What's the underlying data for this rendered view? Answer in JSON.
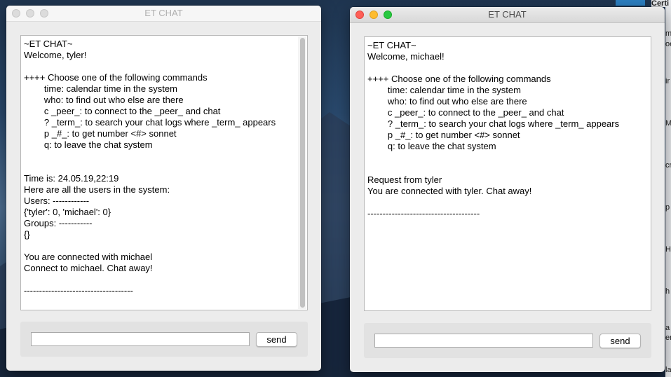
{
  "desktop": {
    "right_fragments": [
      "Certi",
      "m",
      "oe",
      "ir",
      "M",
      "cr",
      "p",
      "H",
      "h",
      "a",
      "er",
      "lar"
    ]
  },
  "windows": [
    {
      "title": "ET CHAT",
      "log_lines": [
        "~ET CHAT~",
        "Welcome, tyler!",
        "",
        "++++ Choose one of the following commands",
        "        time: calendar time in the system",
        "        who: to find out who else are there",
        "        c _peer_: to connect to the _peer_ and chat",
        "        ? _term_: to search your chat logs where _term_ appears",
        "        p _#_: to get number <#> sonnet",
        "        q: to leave the chat system",
        "",
        "",
        "Time is: 24.05.19,22:19",
        "Here are all the users in the system:",
        "Users: ------------",
        "{'tyler': 0, 'michael': 0}",
        "Groups: -----------",
        "{}",
        "",
        "You are connected with michael",
        "Connect to michael. Chat away!",
        "",
        "------------------------------------"
      ],
      "input_value": "",
      "send_label": "send"
    },
    {
      "title": "ET CHAT",
      "log_lines": [
        "~ET CHAT~",
        "Welcome, michael!",
        "",
        "++++ Choose one of the following commands",
        "        time: calendar time in the system",
        "        who: to find out who else are there",
        "        c _peer_: to connect to the _peer_ and chat",
        "        ? _term_: to search your chat logs where _term_ appears",
        "        p _#_: to get number <#> sonnet",
        "        q: to leave the chat system",
        "",
        "",
        "Request from tyler",
        "You are connected with tyler. Chat away!",
        "",
        "-------------------------------------"
      ],
      "input_value": "",
      "send_label": "send"
    }
  ]
}
